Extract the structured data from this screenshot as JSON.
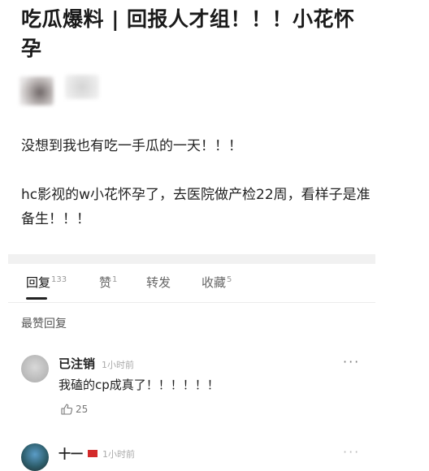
{
  "post": {
    "title": "吃瓜爆料 | 回报人才组！！！小花怀孕",
    "paragraph1": "没想到我也有吃一手瓜的一天！！！",
    "paragraph2": "hc影视的w小花怀孕了，去医院做产检22周，看样子是准备生！！！"
  },
  "tabs": [
    {
      "label": "回复",
      "count": "133"
    },
    {
      "label": "赞",
      "count": "1"
    },
    {
      "label": "转发",
      "count": ""
    },
    {
      "label": "收藏",
      "count": "5"
    }
  ],
  "section_label": "最赞回复",
  "comments": [
    {
      "username": "已注销",
      "timestamp": "1小时前",
      "text": "我磕的cp成真了！！！！！！",
      "likes": "25",
      "more": "···"
    },
    {
      "username": "十一",
      "timestamp": "1小时前",
      "more": "···"
    }
  ],
  "icons": {
    "thumbs_up": "thumbs-up-icon",
    "more": "more-icon",
    "flag": "flag-icon"
  }
}
